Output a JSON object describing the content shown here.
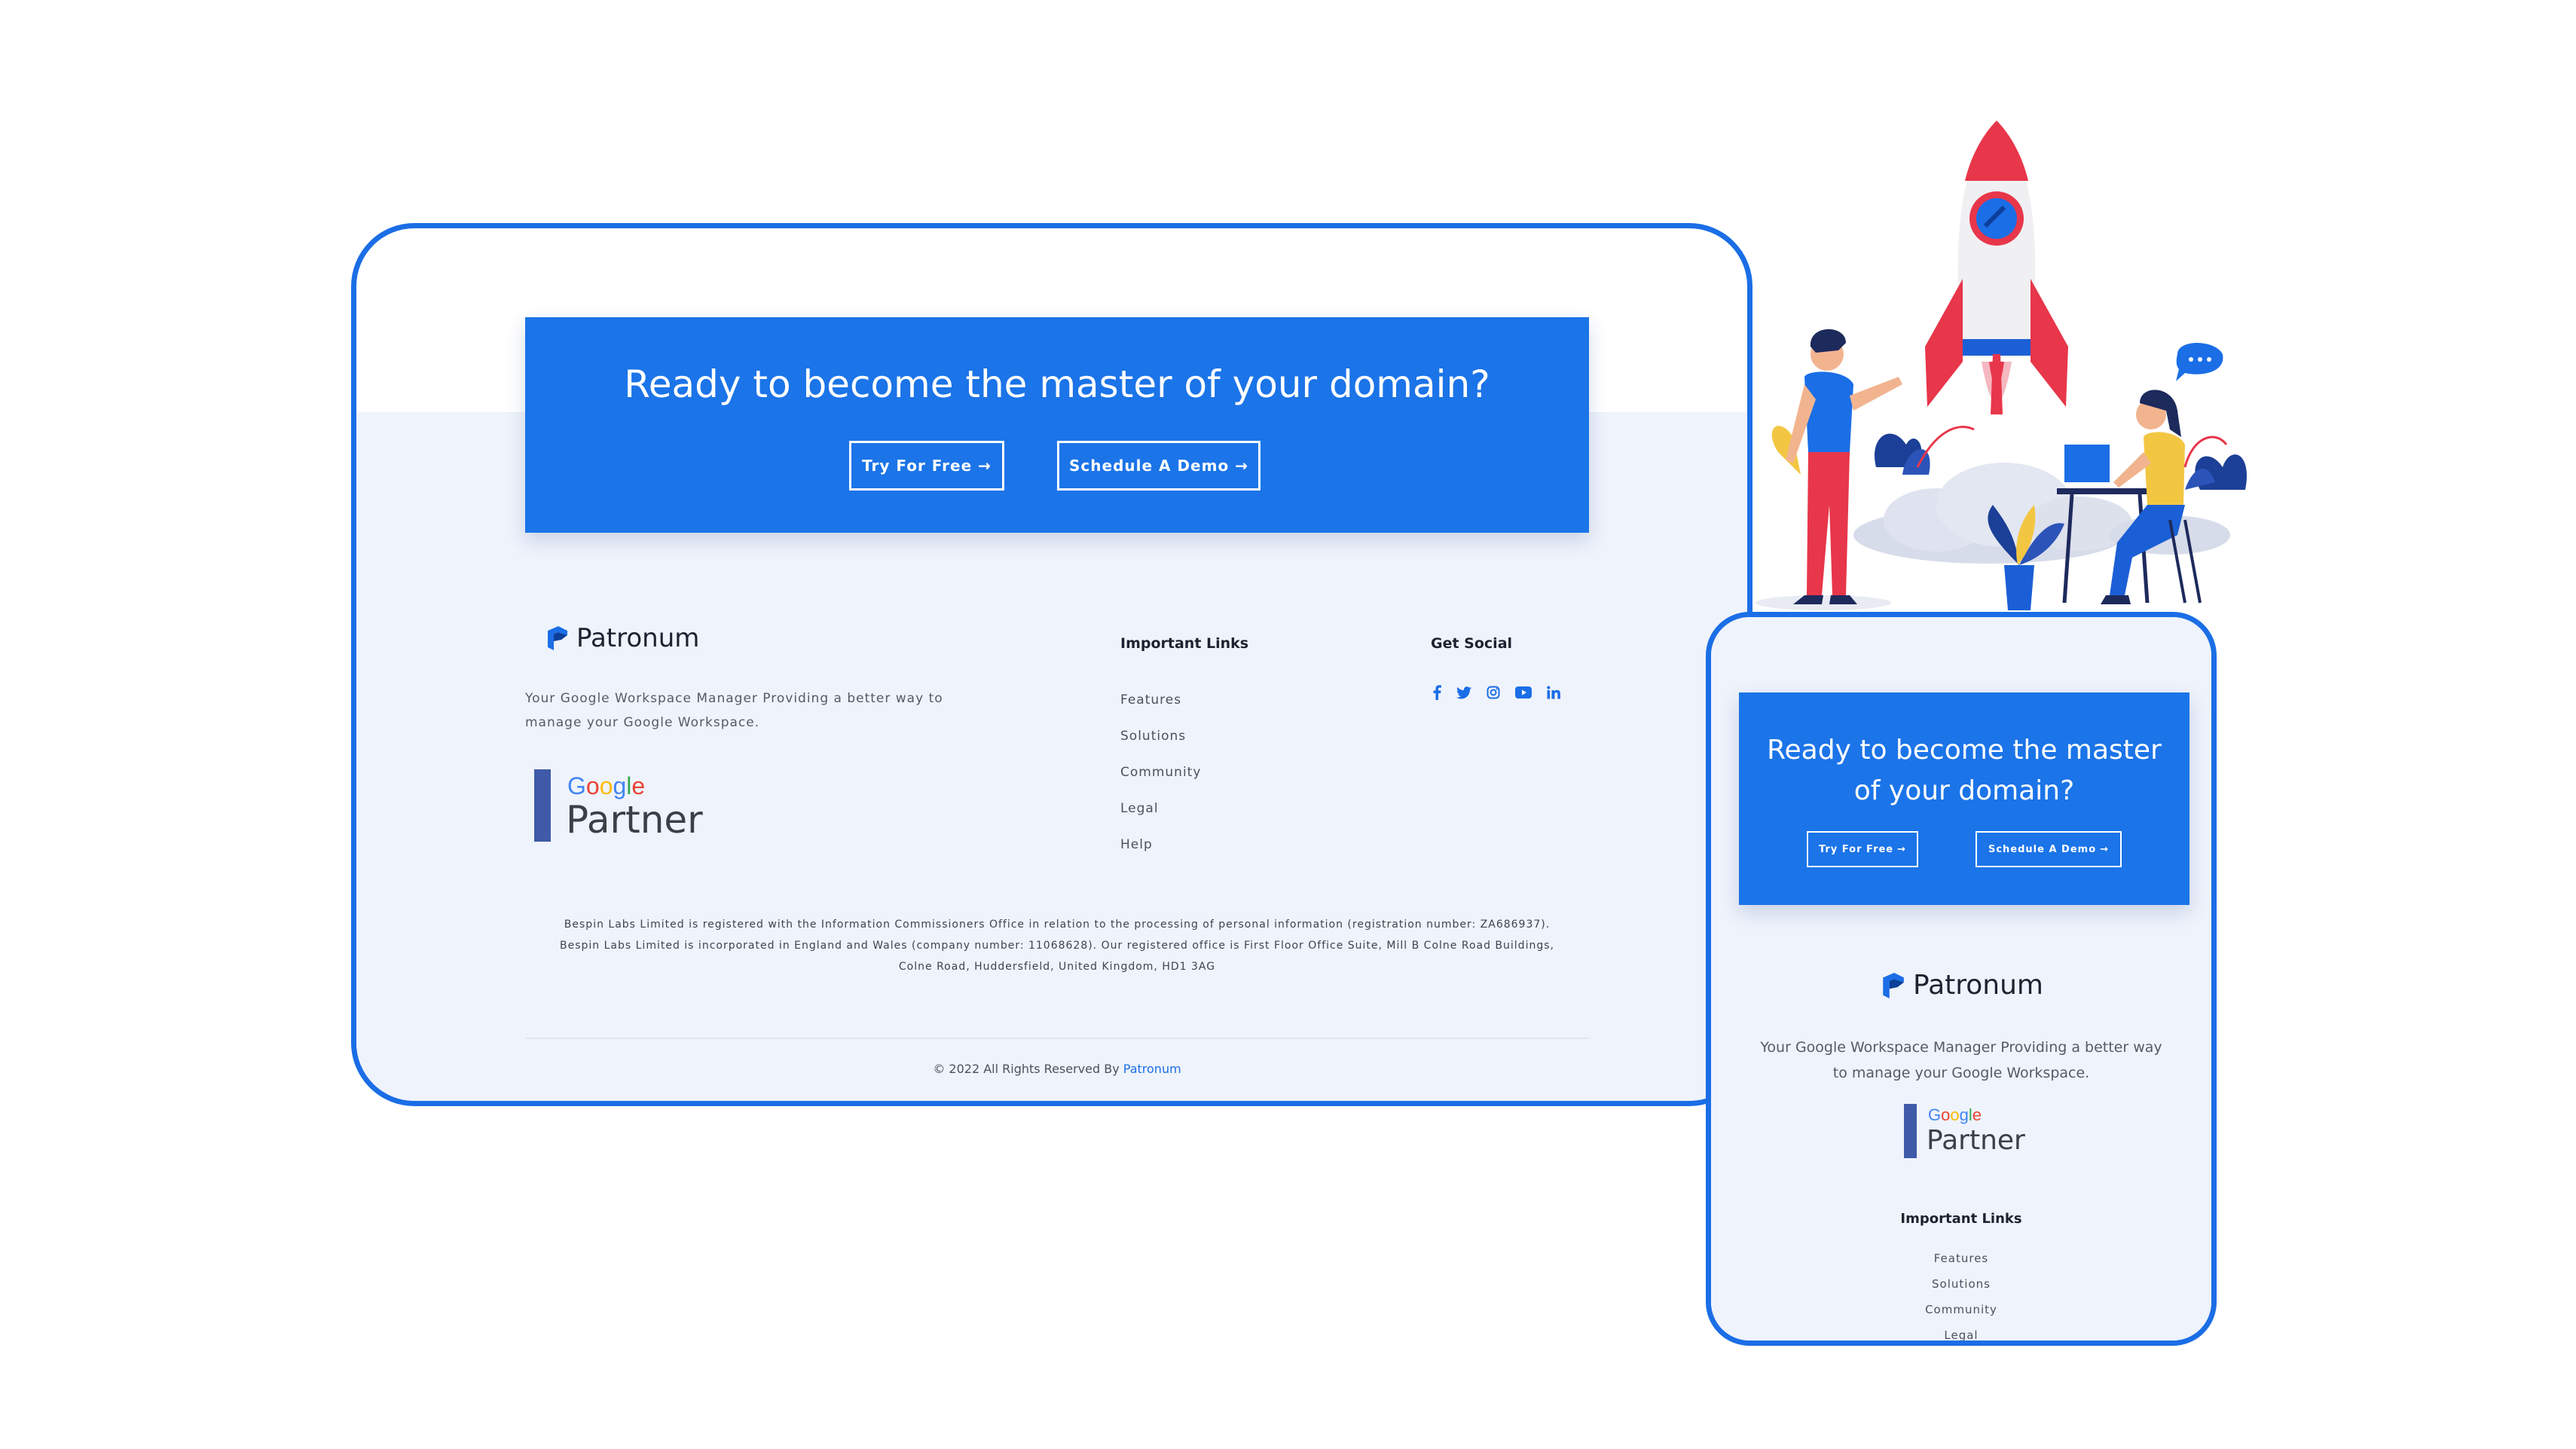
{
  "desktop": {
    "cta": {
      "title": "Ready to become the master of your domain?",
      "try_label": "Try For Free",
      "demo_label": "Schedule A Demo",
      "arrow": "→"
    },
    "brand": {
      "name": "Patronum"
    },
    "description_line1": "Your Google Workspace Manager Providing a better way to",
    "description_line2": "manage your Google Workspace.",
    "google_partner": {
      "google": "Google",
      "partner": "Partner"
    },
    "important_links": {
      "heading": "Important Links",
      "items": [
        "Features",
        "Solutions",
        "Community",
        "Legal",
        "Help"
      ]
    },
    "social": {
      "heading": "Get Social",
      "icons": [
        "facebook-icon",
        "twitter-icon",
        "instagram-icon",
        "youtube-icon",
        "linkedin-icon"
      ]
    },
    "legal": {
      "line1": "Bespin Labs Limited is registered with the Information Commissioners Office in relation to the processing of personal information (registration number: ZA686937).",
      "line2": "Bespin Labs Limited is incorporated in England and Wales (company number: 11068628). Our registered office is First Floor Office Suite, Mill B Colne Road Buildings,",
      "line3": "Colne Road, Huddersfield, United Kingdom, HD1 3AG"
    },
    "copyright": {
      "prefix": "© 2022 All Rights Reserved By",
      "brand": "Patronum"
    }
  },
  "mobile": {
    "cta": {
      "title_line1": "Ready to become the master",
      "title_line2": "of your domain?",
      "try_label": "Try For Free",
      "demo_label": "Schedule A Demo",
      "arrow": "→"
    },
    "brand": {
      "name": "Patronum"
    },
    "description_line1": "Your Google Workspace Manager Providing a better way",
    "description_line2": "to manage your Google Workspace.",
    "google_partner": {
      "google": "Google",
      "partner": "Partner"
    },
    "important_links": {
      "heading": "Important Links",
      "items": [
        "Features",
        "Solutions",
        "Community",
        "Legal"
      ]
    }
  },
  "colors": {
    "accent": "#1b6ee6",
    "cta_bg": "#1b74e8",
    "footer_bg": "#eff3fb",
    "rocket_red": "#e8364a"
  }
}
